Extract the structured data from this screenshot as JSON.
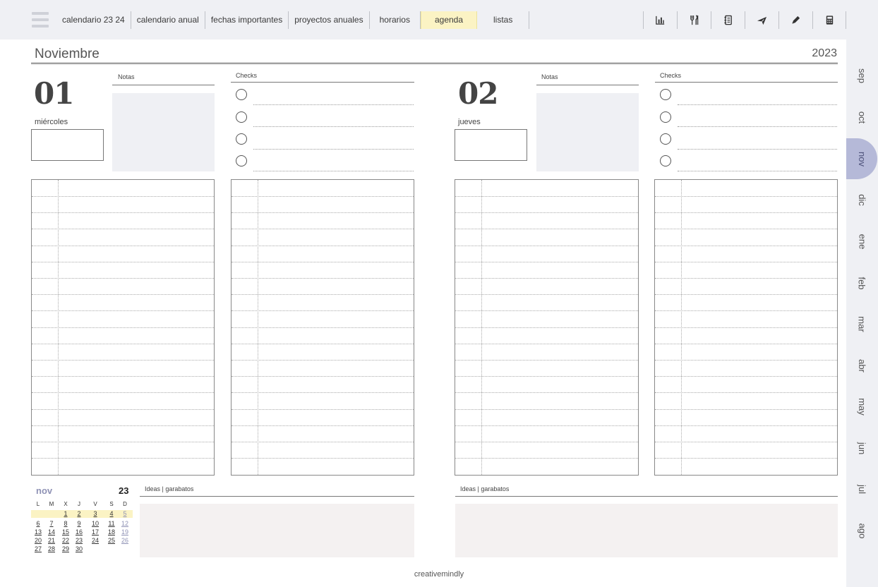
{
  "nav": {
    "tabs": [
      {
        "label": "calendario 23 24"
      },
      {
        "label": "calendario anual"
      },
      {
        "label": "fechas importantes"
      },
      {
        "label": "proyectos anuales"
      },
      {
        "label": "horarios"
      },
      {
        "label": "agenda",
        "active": true
      },
      {
        "label": "listas"
      }
    ],
    "icons": [
      "bar-chart-icon",
      "cutlery-icon",
      "notebook-icon",
      "airplane-icon",
      "pencil-icon",
      "calculator-icon"
    ]
  },
  "header": {
    "title": "Noviembre",
    "year": "2023"
  },
  "days": [
    {
      "number": "01",
      "weekday": "miércoles",
      "notes_label": "Notas",
      "checks_label": "Checks"
    },
    {
      "number": "02",
      "weekday": "jueves",
      "notes_label": "Notas",
      "checks_label": "Checks"
    }
  ],
  "months": [
    "sep",
    "oct",
    "nov",
    "dic",
    "ene",
    "feb",
    "mar",
    "abr",
    "may",
    "jun",
    "jul",
    "ago"
  ],
  "active_month": "nov",
  "mini_calendar": {
    "month": "nov",
    "year": "23",
    "weekdays": [
      "L",
      "M",
      "X",
      "J",
      "V",
      "S",
      "D"
    ],
    "weeks": [
      [
        "",
        "",
        "1",
        "2",
        "3",
        "4",
        "5"
      ],
      [
        "6",
        "7",
        "8",
        "9",
        "10",
        "11",
        "12"
      ],
      [
        "13",
        "14",
        "15",
        "16",
        "17",
        "18",
        "19"
      ],
      [
        "20",
        "21",
        "22",
        "23",
        "24",
        "25",
        "26"
      ],
      [
        "27",
        "28",
        "29",
        "30",
        "",
        "",
        ""
      ]
    ]
  },
  "ideas": {
    "label": "Ideas | garabatos"
  },
  "footer": {
    "text": "creativemindly"
  },
  "colors": {
    "topbar": "#eff0f4",
    "active_tab": "#fbf3c4",
    "active_month": "#b5b9d8",
    "notes_fill": "#eff0f4",
    "ideas_fill": "#f4f1f1",
    "accent_text": "#8f92b5"
  }
}
